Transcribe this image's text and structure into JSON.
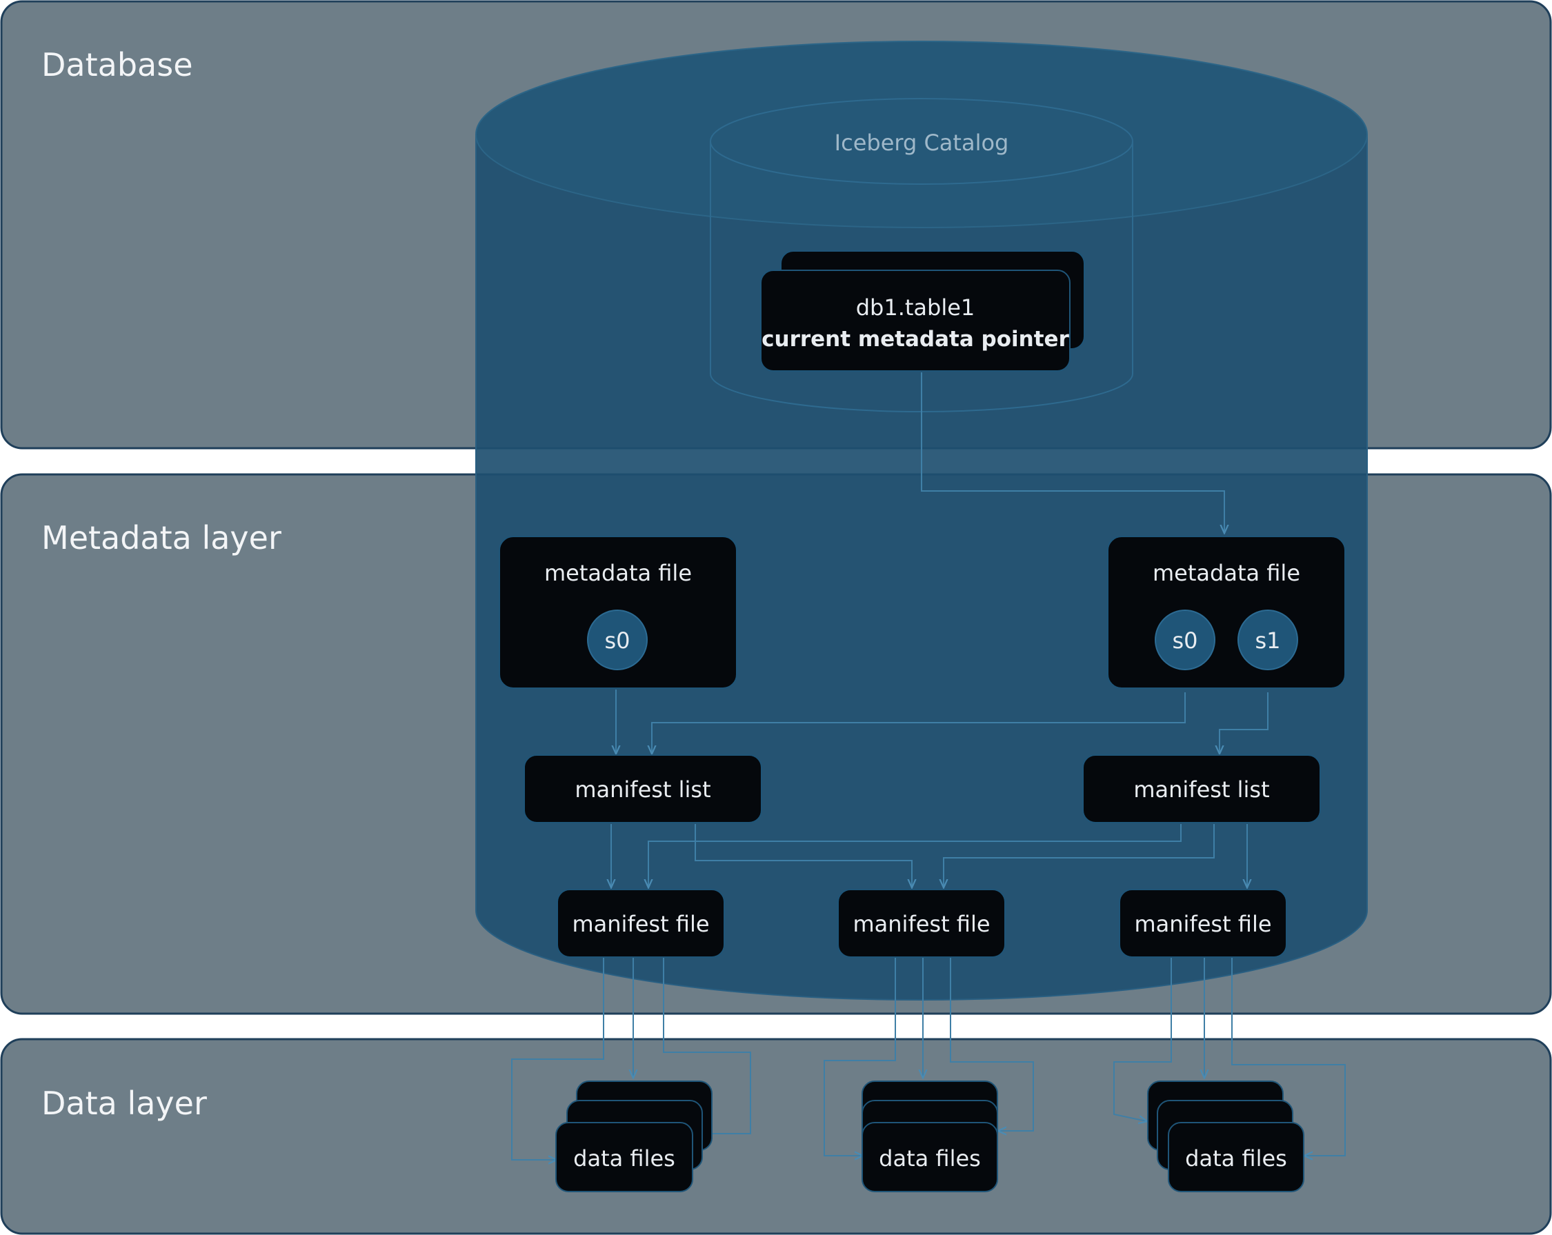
{
  "layers": {
    "database": "Database",
    "metadata": "Metadata layer",
    "data": "Data layer"
  },
  "catalog": {
    "label": "Iceberg Catalog",
    "pointer_line1": "db1.table1",
    "pointer_line2": "current metadata pointer"
  },
  "metadata_files": [
    {
      "label": "metadata file",
      "snapshots": [
        "s0"
      ]
    },
    {
      "label": "metadata file",
      "snapshots": [
        "s0",
        "s1"
      ]
    }
  ],
  "manifest_lists": [
    "manifest list",
    "manifest list"
  ],
  "manifest_files": [
    "manifest file",
    "manifest file",
    "manifest file"
  ],
  "data_files": [
    "data files",
    "data files",
    "data files"
  ],
  "colors": {
    "panel": "#6e7e88",
    "panel_border": "#1f3f5a",
    "cylinder": "#1e4f70",
    "node": "#05080c",
    "node_border": "#1f5578",
    "badge": "#1f5578",
    "connector": "#3f7fa6"
  }
}
